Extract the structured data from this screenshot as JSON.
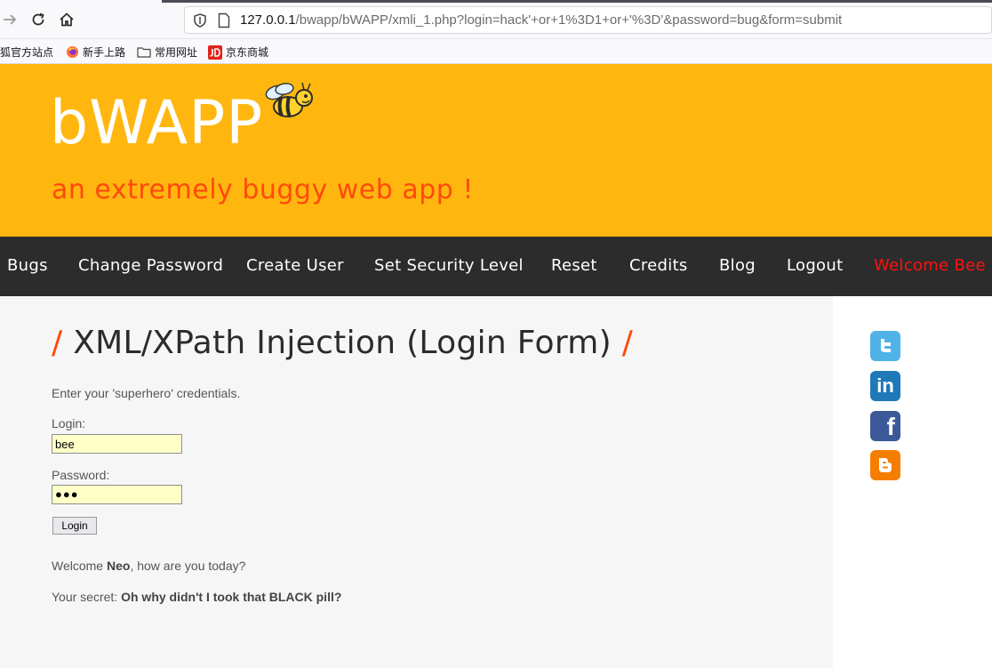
{
  "browser": {
    "url_host": "127.0.0.1",
    "url_path": "/bwapp/bWAPP/xmli_1.php?login=hack'+or+1%3D1+or+'%3D'&password=bug&form=submit",
    "bookmarks": [
      "狐官方站点",
      "新手上路",
      "常用网址",
      "京东商城"
    ]
  },
  "header": {
    "logo": "bWAPP",
    "tagline": "an extremely buggy web app !"
  },
  "menu": {
    "items": [
      "Bugs",
      "Change Password",
      "Create User",
      "Set Security Level",
      "Reset",
      "Credits",
      "Blog",
      "Logout"
    ],
    "welcome": "Welcome Bee"
  },
  "main": {
    "title_slash": "/",
    "title": "XML/XPath Injection (Login Form)",
    "intro": "Enter your 'superhero' credentials.",
    "login_label": "Login:",
    "login_value": "bee",
    "password_label": "Password:",
    "password_value": "●●●",
    "login_button": "Login",
    "welcome_prefix": "Welcome ",
    "welcome_name": "Neo",
    "welcome_suffix": ", how are you today?",
    "secret_prefix": "Your secret: ",
    "secret_value": "Oh why didn't I took that BLACK pill?"
  },
  "social": {
    "icons": [
      "twitter-icon",
      "linkedin-icon",
      "facebook-icon",
      "blogger-icon"
    ],
    "linkedin_text": "in",
    "facebook_text": "f",
    "colors": {
      "twitter": "#4fb3e8",
      "linkedin": "#1f79b8",
      "facebook": "#3b5998",
      "blogger": "#f57d00"
    }
  },
  "colors": {
    "header_bg": "#ffb70f",
    "tagline": "#ff4a0a",
    "menu_bg": "#2c2c2c",
    "welcome": "#ff1010",
    "input_bg": "#ffffc8"
  }
}
